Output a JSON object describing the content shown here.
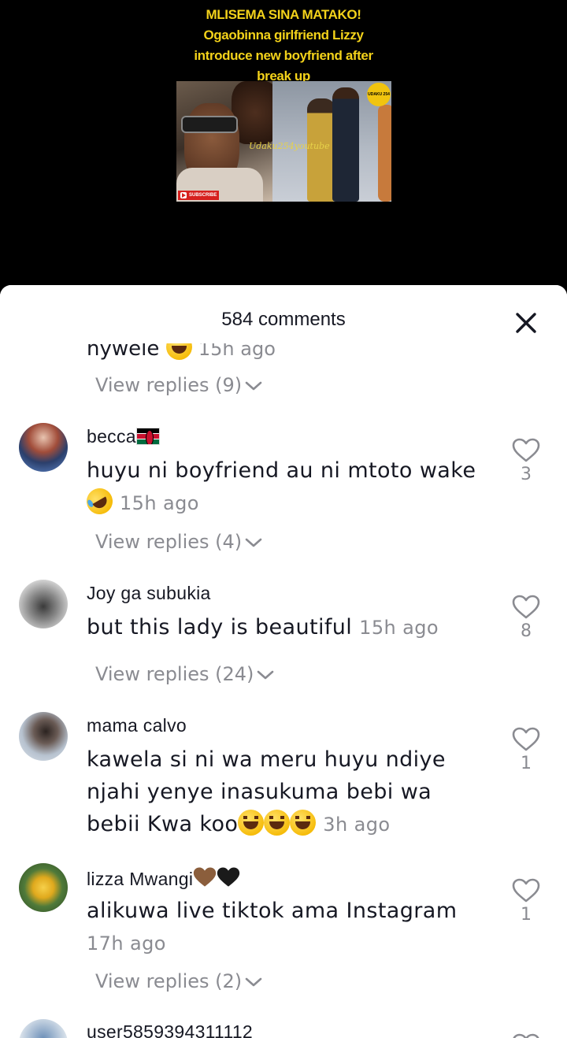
{
  "video": {
    "title_lines": [
      "MLISEMA SINA MATAKO!",
      "Ogaobinna girlfriend Lizzy",
      "introduce new boyfriend after",
      "break up"
    ],
    "watermark": "Udaku254youtube",
    "badge": "UDAKU 254",
    "subscribe_label": "SUBSCRIBE"
  },
  "sheet": {
    "title": "584 comments",
    "close_icon": "close-icon"
  },
  "cut_comment": {
    "text": "nywele",
    "time": "15h ago",
    "replies": "View replies (9)"
  },
  "comments": [
    {
      "username": "becca",
      "username_emoji": "kenya-flag",
      "text": "huyu ni boyfriend au ni mtoto wake",
      "emoji": "rofl-emoji",
      "time": "15h ago",
      "likes": "3",
      "replies": "View replies (4)"
    },
    {
      "username": "Joy ga subukia",
      "text": "but this lady is beautiful",
      "time": "15h ago",
      "likes": "8",
      "replies": "View replies (24)"
    },
    {
      "username": "mama calvo",
      "text_lines": [
        "kawela si ni wa meru huyu ndiye",
        "njahi yenye inasukuma bebi wa",
        "bebii Kwa koo"
      ],
      "emoji": "laughing-emoji",
      "time": "3h ago",
      "likes": "1"
    },
    {
      "username": "lizza Mwangi",
      "username_emoji": "brown-heart black-heart",
      "text": "alikuwa live tiktok ama Instagram",
      "time": "17h ago",
      "likes": "1",
      "replies": "View replies (2)"
    },
    {
      "username": "user5859394311112"
    }
  ],
  "colors": {
    "thumb_title": "#f3d21a",
    "text_primary": "#161823",
    "text_secondary": "#8a8b91",
    "sheet_bg": "#ffffff"
  }
}
